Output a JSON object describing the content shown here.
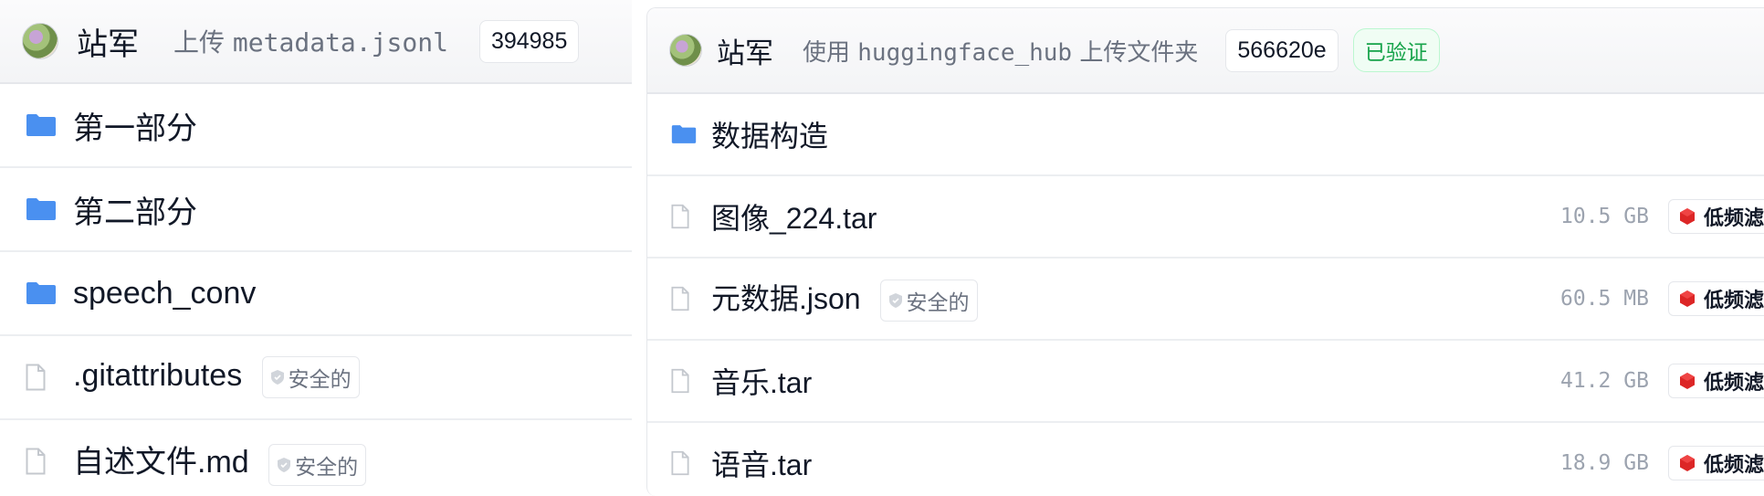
{
  "left_panel": {
    "header": {
      "user": "站军",
      "action_prefix": "上传",
      "action_file": "metadata.jsonl",
      "commit": "394985"
    },
    "rows": [
      {
        "type": "folder",
        "name": "第一部分"
      },
      {
        "type": "folder",
        "name": "第二部分"
      },
      {
        "type": "folder",
        "name": "speech_conv"
      },
      {
        "type": "file",
        "name": ".gitattributes",
        "badge": "安全的"
      },
      {
        "type": "file",
        "name": "自述文件.md",
        "badge": "安全的"
      }
    ]
  },
  "right_panel": {
    "header": {
      "user": "站军",
      "action_prefix": "使用",
      "action_tool": "huggingface_hub",
      "action_suffix": "上传文件夹",
      "commit": "566620e",
      "verified": "已验证"
    },
    "rows": [
      {
        "type": "folder",
        "name": "数据构造"
      },
      {
        "type": "file",
        "name": "图像_224.tar",
        "size": "10.5 GB",
        "lfs": "低频滤"
      },
      {
        "type": "file",
        "name": "元数据.json",
        "badge": "安全的",
        "size": "60.5 MB",
        "lfs": "低频滤"
      },
      {
        "type": "file",
        "name": "音乐.tar",
        "size": "41.2 GB",
        "lfs": "低频滤"
      },
      {
        "type": "file",
        "name": "语音.tar",
        "size": "18.9 GB",
        "lfs": "低频滤"
      }
    ]
  },
  "colors": {
    "folder": "#4a90f0",
    "lfs": "#dc2626",
    "verified": "#16a34a"
  },
  "icons": {
    "folder": "folder-icon",
    "file": "file-icon",
    "safe": "shield-icon",
    "lfs": "lfs-icon"
  }
}
